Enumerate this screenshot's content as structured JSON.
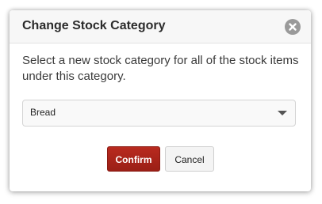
{
  "dialog": {
    "title": "Change Stock Category",
    "close_icon": "close-icon",
    "message": "Select a new stock category for all of the stock items under this category.",
    "category_select": {
      "selected_value": "Bread",
      "dropdown_icon": "chevron-down-icon"
    },
    "buttons": {
      "confirm_label": "Confirm",
      "cancel_label": "Cancel"
    }
  },
  "colors": {
    "confirm_button": "#a8261c",
    "close_button": "#9a9a9a",
    "header_background": "#f7f7f7"
  }
}
